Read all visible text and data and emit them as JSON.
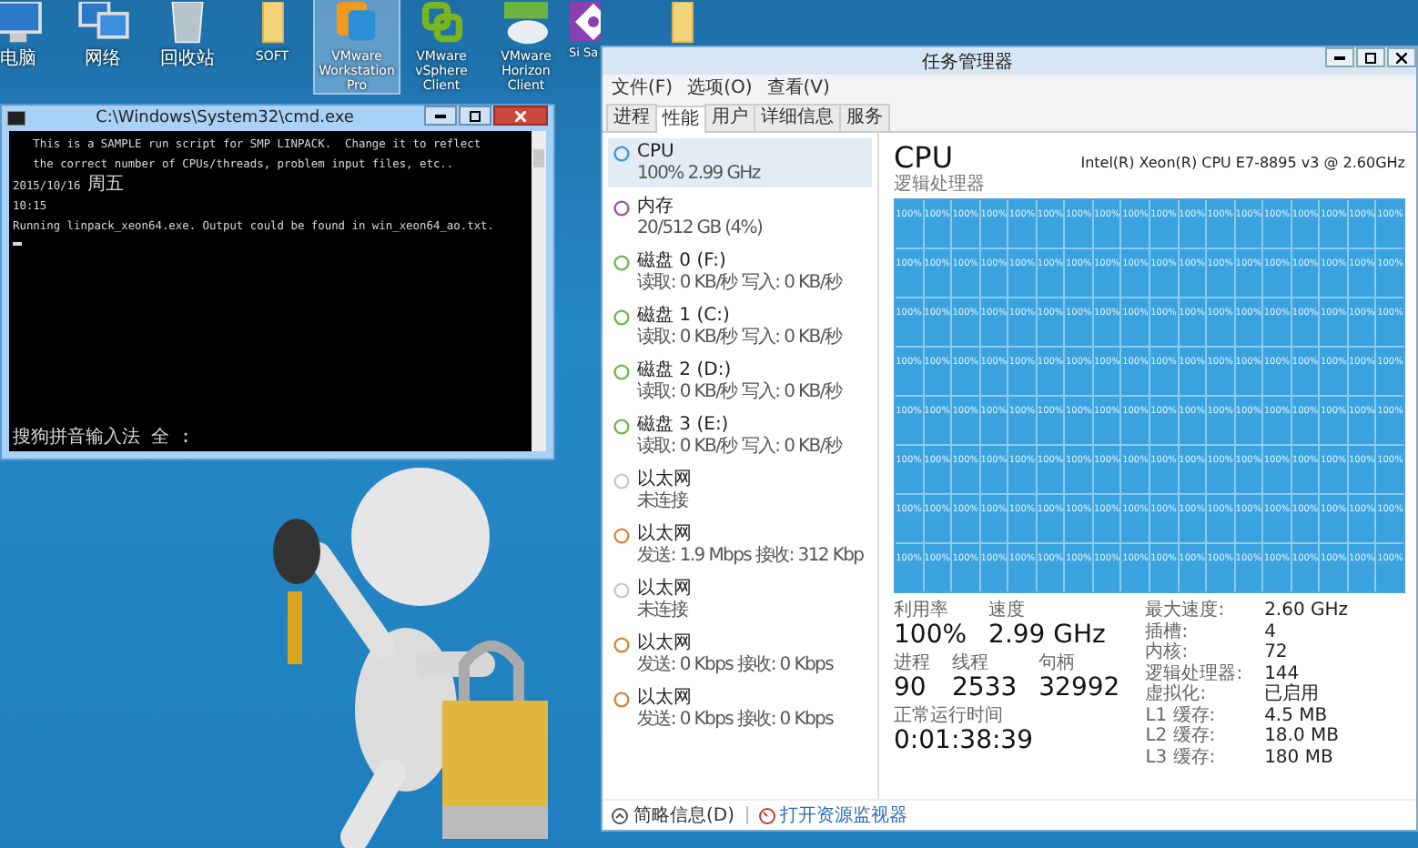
{
  "desktop": {
    "icons": [
      {
        "kind": "computer",
        "label": "电脑",
        "selected": false
      },
      {
        "kind": "network",
        "label": "网络",
        "selected": false
      },
      {
        "kind": "recycle-bin",
        "label": "回收站",
        "selected": false
      },
      {
        "kind": "folder",
        "label": "SOFT",
        "selected": false
      },
      {
        "kind": "workstation",
        "label": "VMware Workstation Pro",
        "selected": true
      },
      {
        "kind": "vsphere",
        "label": "VMware vSphere Client",
        "selected": false
      },
      {
        "kind": "horizon",
        "label": "VMware Horizon Client",
        "selected": false
      },
      {
        "kind": "diamond",
        "label": "Si Sa",
        "selected": false
      },
      {
        "kind": "folder",
        "selected": false
      }
    ]
  },
  "cmd_window": {
    "title": "C:\\Windows\\System32\\cmd.exe",
    "lines": [
      "   This is a SAMPLE run script for SMP LINPACK.  Change it to reflect",
      "   the correct number of CPUs/threads, problem input files, etc..",
      "2015/10/16 周五",
      "10:15",
      "Running linpack_xeon64.exe. Output could be found in win_xeon64_ao.txt."
    ],
    "ime_status": "搜狗拼音输入法 全 :"
  },
  "task_manager": {
    "title": "任务管理器",
    "menu": [
      "文件(F)",
      "选项(O)",
      "查看(V)"
    ],
    "tabs": [
      {
        "label": "进程",
        "selected": false
      },
      {
        "label": "性能",
        "selected": true
      },
      {
        "label": "用户",
        "selected": false
      },
      {
        "label": "详细信息",
        "selected": false
      },
      {
        "label": "服务",
        "selected": false
      }
    ],
    "sidebar": [
      {
        "title": "CPU",
        "detail": "100% 2.99 GHz",
        "color": "#3c9ad6",
        "selected": true
      },
      {
        "title": "内存",
        "detail": "20/512 GB (4%)",
        "color": "#9b4fb5",
        "selected": false
      },
      {
        "title": "磁盘 0 (F:)",
        "detail": "读取: 0 KB/秒 写入: 0 KB/秒",
        "color": "#6cb84a",
        "selected": false
      },
      {
        "title": "磁盘 1 (C:)",
        "detail": "读取: 0 KB/秒 写入: 0 KB/秒",
        "color": "#6cb84a",
        "selected": false
      },
      {
        "title": "磁盘 2 (D:)",
        "detail": "读取: 0 KB/秒 写入: 0 KB/秒",
        "color": "#6cb84a",
        "selected": false
      },
      {
        "title": "磁盘 3 (E:)",
        "detail": "读取: 0 KB/秒 写入: 0 KB/秒",
        "color": "#6cb84a",
        "selected": false
      },
      {
        "title": "以太网",
        "detail": "未连接",
        "color": "#c8c8c8",
        "selected": false
      },
      {
        "title": "以太网",
        "detail": "发送: 1.9 Mbps 接收: 312 Kbp",
        "color": "#d0873a",
        "selected": false
      },
      {
        "title": "以太网",
        "detail": "未连接",
        "color": "#c8c8c8",
        "selected": false
      },
      {
        "title": "以太网",
        "detail": "发送: 0 Kbps 接收: 0 Kbps",
        "color": "#d0873a",
        "selected": false
      },
      {
        "title": "以太网",
        "detail": "发送: 0 Kbps 接收: 0 Kbps",
        "color": "#d0873a",
        "selected": false
      }
    ],
    "cpu": {
      "title": "CPU",
      "model": "Intel(R) Xeon(R) CPU E7-8895 v3 @ 2.60GHz",
      "grid_label": "逻辑处理器",
      "logical_processors": [
        "100%",
        "100%",
        "100%",
        "100%",
        "100%",
        "100%",
        "100%",
        "100%",
        "100%",
        "100%",
        "100%",
        "100%",
        "100%",
        "100%",
        "100%",
        "100%",
        "100%",
        "100%",
        "100%",
        "100%",
        "100%",
        "100%",
        "100%",
        "100%",
        "100%",
        "100%",
        "100%",
        "100%",
        "100%",
        "100%",
        "100%",
        "100%",
        "100%",
        "100%",
        "100%",
        "100%",
        "100%",
        "100%",
        "100%",
        "100%",
        "100%",
        "100%",
        "100%",
        "100%",
        "100%",
        "100%",
        "100%",
        "100%",
        "100%",
        "100%",
        "100%",
        "100%",
        "100%",
        "100%",
        "100%",
        "100%",
        "100%",
        "100%",
        "100%",
        "100%",
        "100%",
        "100%",
        "100%",
        "100%",
        "100%",
        "100%",
        "100%",
        "100%",
        "100%",
        "100%",
        "100%",
        "100%",
        "100%",
        "100%",
        "100%",
        "100%",
        "100%",
        "100%",
        "100%",
        "100%",
        "100%",
        "100%",
        "100%",
        "100%",
        "100%",
        "100%",
        "100%",
        "100%",
        "100%",
        "100%",
        "100%",
        "100%",
        "100%",
        "100%",
        "100%",
        "100%",
        "100%",
        "100%",
        "100%",
        "100%",
        "100%",
        "100%",
        "100%",
        "100%",
        "100%",
        "100%",
        "100%",
        "100%",
        "100%",
        "100%",
        "100%",
        "100%",
        "100%",
        "100%",
        "100%",
        "100%",
        "100%",
        "100%",
        "100%",
        "100%",
        "100%",
        "100%",
        "100%",
        "100%",
        "100%",
        "100%",
        "100%",
        "100%",
        "100%",
        "100%",
        "100%",
        "100%",
        "100%",
        "100%",
        "100%",
        "100%",
        "100%",
        "100%",
        "100%",
        "100%",
        "100%",
        "100%",
        "100%",
        "100%"
      ],
      "stat_rows": [
        [
          {
            "label": "利用率",
            "value": "100%"
          },
          {
            "label": "速度",
            "value": "2.99 GHz"
          }
        ],
        [
          {
            "label": "进程",
            "value": "90"
          },
          {
            "label": "线程",
            "value": "2533"
          },
          {
            "label": "句柄",
            "value": "32992"
          }
        ],
        [
          {
            "label": "正常运行时间",
            "value": "0:01:38:39"
          }
        ]
      ],
      "specs": [
        {
          "label": "最大速度:",
          "value": "2.60 GHz"
        },
        {
          "label": "插槽:",
          "value": "4"
        },
        {
          "label": "内核:",
          "value": "72"
        },
        {
          "label": "逻辑处理器:",
          "value": "144"
        },
        {
          "label": "虚拟化:",
          "value": "已启用"
        },
        {
          "label": "L1 缓存:",
          "value": "4.5 MB"
        },
        {
          "label": "L2 缓存:",
          "value": "18.0 MB"
        },
        {
          "label": "L3 缓存:",
          "value": "180 MB"
        }
      ]
    },
    "footer": {
      "fewer_details": "简略信息(D)",
      "resource_monitor": "打开资源监视器"
    }
  }
}
